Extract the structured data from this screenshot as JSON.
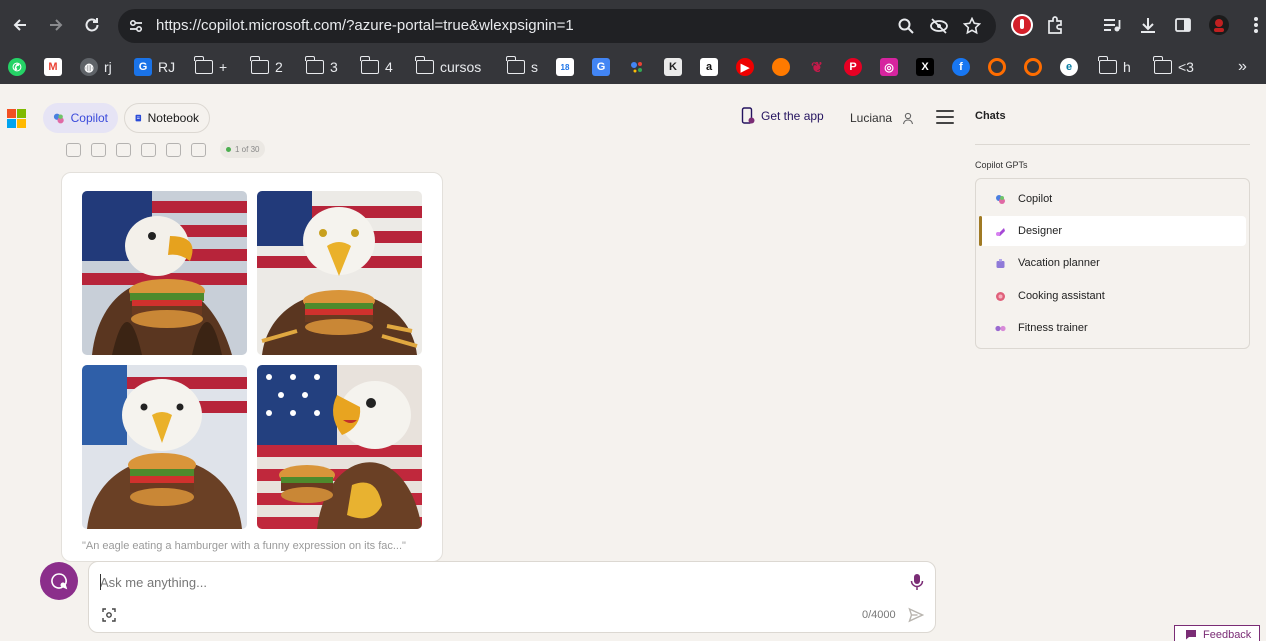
{
  "browser": {
    "url": "https://copilot.microsoft.com/?azure-portal=true&wlexpsignin=1",
    "bookmarks": [
      {
        "label": "",
        "icon": "whatsapp-icon"
      },
      {
        "label": "",
        "icon": "gmail-icon"
      },
      {
        "label": "rj",
        "icon": "globe-icon"
      },
      {
        "label": "RJ",
        "icon": "rj-app-icon"
      },
      {
        "label": "+",
        "icon": "folder-icon"
      },
      {
        "label": "2",
        "icon": "folder-icon"
      },
      {
        "label": "3",
        "icon": "folder-icon"
      },
      {
        "label": "4",
        "icon": "folder-icon"
      },
      {
        "label": "cursos",
        "icon": "folder-icon"
      },
      {
        "label": "s",
        "icon": "folder-icon"
      },
      {
        "label": "",
        "icon": "calendar-icon"
      },
      {
        "label": "",
        "icon": "translate-icon"
      },
      {
        "label": "",
        "icon": "assistant-icon"
      },
      {
        "label": "",
        "icon": "k-app-icon"
      },
      {
        "label": "",
        "icon": "amazon-icon"
      },
      {
        "label": "",
        "icon": "youtube-music-icon"
      },
      {
        "label": "",
        "icon": "orange-app-icon"
      },
      {
        "label": "",
        "icon": "raspberry-icon"
      },
      {
        "label": "",
        "icon": "pinterest-icon"
      },
      {
        "label": "",
        "icon": "instagram-icon"
      },
      {
        "label": "",
        "icon": "x-icon"
      },
      {
        "label": "",
        "icon": "facebook-icon"
      },
      {
        "label": "",
        "icon": "orange-circle-icon"
      },
      {
        "label": "",
        "icon": "orange-circle-icon"
      },
      {
        "label": "",
        "icon": "e-app-icon"
      },
      {
        "label": "h",
        "icon": "folder-icon"
      },
      {
        "label": "<3",
        "icon": "folder-icon"
      }
    ]
  },
  "header": {
    "tabs": [
      {
        "label": "Copilot",
        "active": true
      },
      {
        "label": "Notebook",
        "active": false
      }
    ],
    "get_app": "Get the app",
    "user_name": "Luciana"
  },
  "message": {
    "page_counter": "1 of 30",
    "caption": "\"An eagle eating a hamburger with a funny expression on its fac...\""
  },
  "composer": {
    "placeholder": "Ask me anything...",
    "char_count": "0/4000"
  },
  "feedback": "Feedback",
  "sidebar": {
    "title": "Chats",
    "section_label": "Copilot GPTs",
    "gpts": [
      {
        "label": "Copilot",
        "active": false,
        "color": "#4a7fe0"
      },
      {
        "label": "Designer",
        "active": true,
        "color": "#a648d6"
      },
      {
        "label": "Vacation planner",
        "active": false,
        "color": "#8f7ad8"
      },
      {
        "label": "Cooking assistant",
        "active": false,
        "color": "#e0607a"
      },
      {
        "label": "Fitness trainer",
        "active": false,
        "color": "#9a6ad0"
      }
    ]
  },
  "colors": {
    "chrome_bg": "#35363a",
    "page_bg": "#f5f2ee",
    "accent_purple": "#8b2e8b",
    "designer_bar": "#a07a24"
  }
}
